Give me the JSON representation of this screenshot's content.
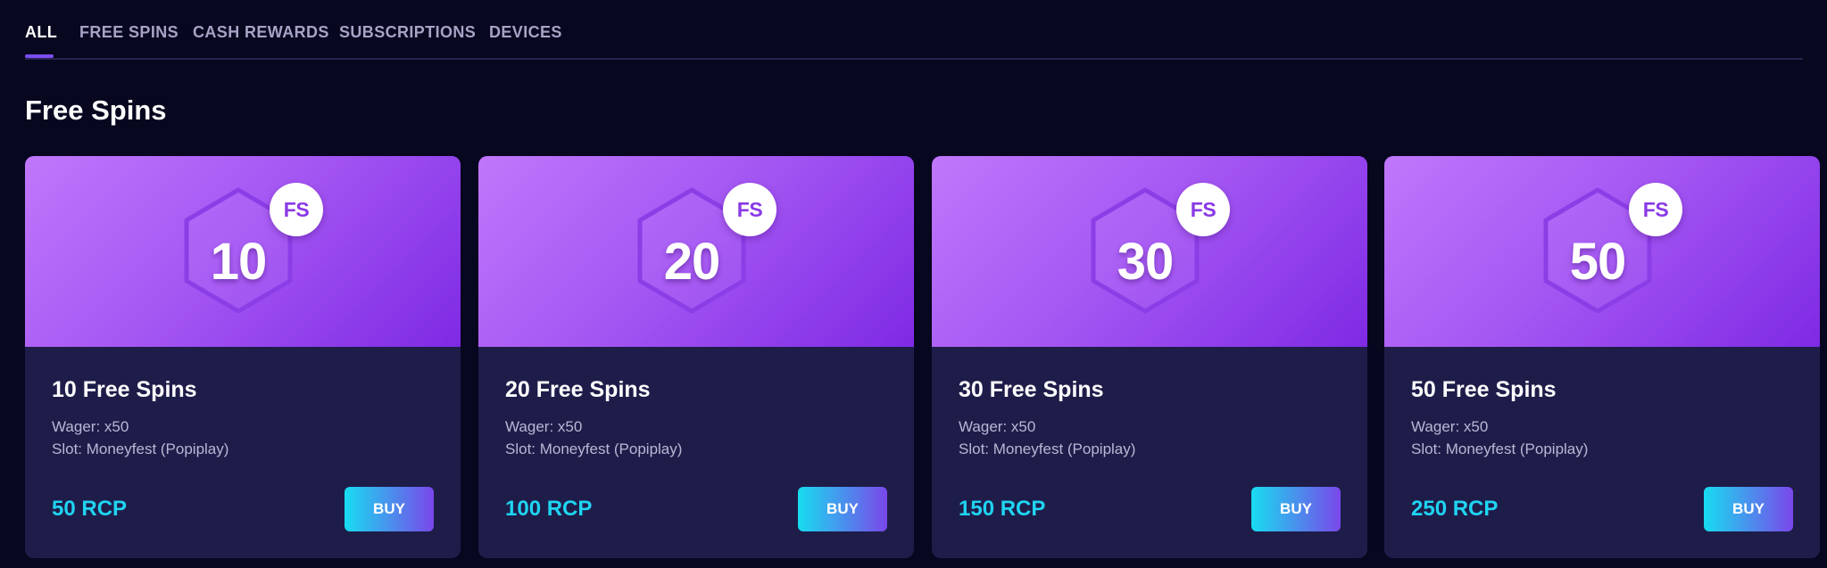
{
  "tabs": [
    {
      "label": "ALL",
      "active": true
    },
    {
      "label": "FREE SPINS",
      "active": false
    },
    {
      "label": "CASH REWARDS",
      "active": false
    },
    {
      "label": "SUBSCRIPTIONS",
      "active": false
    },
    {
      "label": "DEVICES",
      "active": false
    }
  ],
  "section": {
    "title": "Free Spins"
  },
  "cards": [
    {
      "hero_number": "10",
      "badge": "FS",
      "title": "10 Free Spins",
      "wager": "Wager: x50",
      "slot": "Slot: Moneyfest (Popiplay)",
      "price": "50 RCP",
      "buy_label": "BUY"
    },
    {
      "hero_number": "20",
      "badge": "FS",
      "title": "20 Free Spins",
      "wager": "Wager: x50",
      "slot": "Slot: Moneyfest (Popiplay)",
      "price": "100 RCP",
      "buy_label": "BUY"
    },
    {
      "hero_number": "30",
      "badge": "FS",
      "title": "30 Free Spins",
      "wager": "Wager: x50",
      "slot": "Slot: Moneyfest (Popiplay)",
      "price": "150 RCP",
      "buy_label": "BUY"
    },
    {
      "hero_number": "50",
      "badge": "FS",
      "title": "50 Free Spins",
      "wager": "Wager: x50",
      "slot": "Slot: Moneyfest (Popiplay)",
      "price": "250 RCP",
      "buy_label": "BUY"
    }
  ],
  "colors": {
    "background": "#070720",
    "card": "#1e1d4a",
    "accent": "#7b4df0",
    "price": "#1fd4f1",
    "hero_gradient_start": "#c077fb",
    "hero_gradient_end": "#7e2ae4"
  },
  "icons": {
    "hero": "hexagon-icon",
    "badge": "free-spins-badge-icon"
  }
}
